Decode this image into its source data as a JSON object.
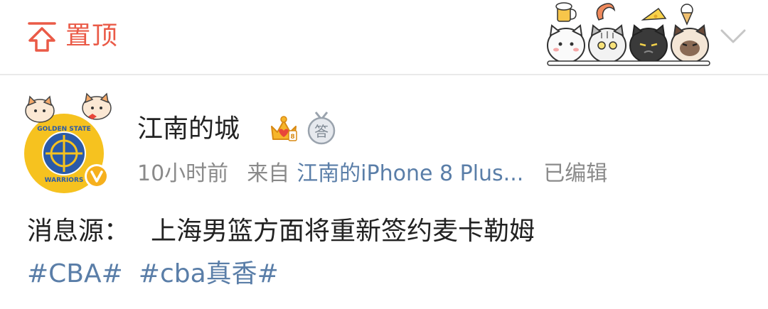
{
  "pinned": {
    "label": "置顶",
    "icon": "pin-top-icon",
    "accent_color": "#ea5a47"
  },
  "stickers": [
    "beer-cat-sticker",
    "shrimp-cat-sticker",
    "cheese-black-cat-sticker",
    "icecream-siamese-cat-sticker"
  ],
  "post": {
    "author": {
      "name": "江南的城",
      "avatar_icon": "golden-state-warriors-logo",
      "avatar_text_top": "GOLDEN STATE",
      "avatar_text_bottom": "WARRIORS",
      "verified_badge": "verified-v-icon",
      "badges": [
        "crown-vip-icon",
        "answer-medal-icon"
      ],
      "answer_badge_text": "答"
    },
    "time": "10小时前",
    "source_prefix": "来自",
    "source": "江南的iPhone 8 Plus...",
    "edited": "已编辑",
    "text_prefix": "消息源：",
    "text_body": "上海男篮方面将重新签约麦卡勒姆",
    "tags": [
      "#CBA#",
      "#cba真香#"
    ],
    "link_color": "#5a7ea8"
  }
}
